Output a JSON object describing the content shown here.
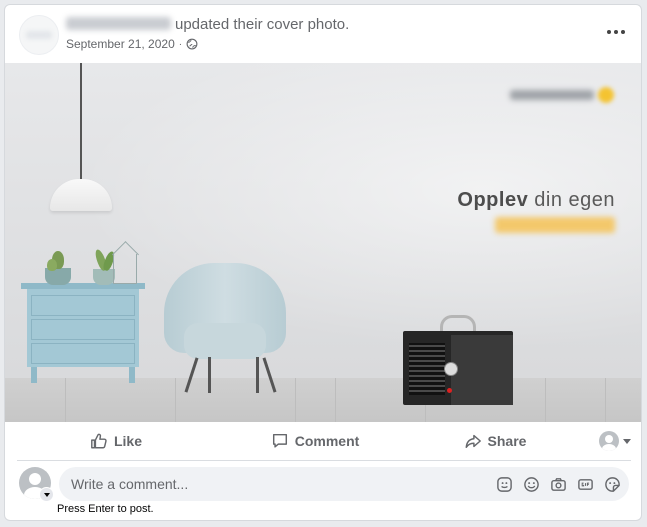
{
  "post": {
    "action_text": "updated their cover photo.",
    "date": "September 21, 2020",
    "separator": "·",
    "more_menu_icon": "more-horizontal-icon",
    "audience_icon": "globe-icon"
  },
  "cover_photo": {
    "headline_bold": "Opplev",
    "headline_rest": " din egen"
  },
  "actions": {
    "like_label": "Like",
    "comment_label": "Comment",
    "share_label": "Share"
  },
  "composer": {
    "placeholder": "Write a comment...",
    "hint": "Press Enter to post.",
    "tools": [
      "sticker-icon",
      "emoji-icon",
      "camera-icon",
      "gif-icon",
      "sticker-face-icon"
    ]
  },
  "colors": {
    "text_secondary": "#65676b",
    "comment_bg": "#f0f2f5",
    "accent_yellow": "#f4c331"
  }
}
